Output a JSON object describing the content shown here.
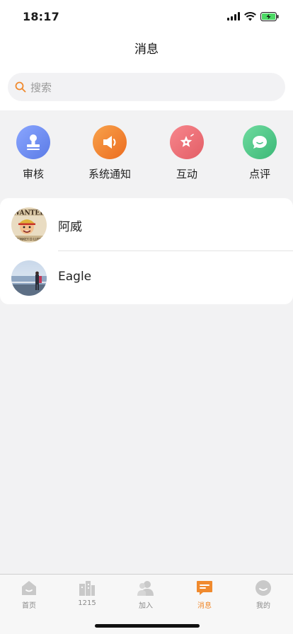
{
  "status_bar": {
    "time": "18:17"
  },
  "header": {
    "title": "消息"
  },
  "search": {
    "placeholder": "搜索"
  },
  "categories": [
    {
      "label": "审核",
      "icon": "stamp-icon",
      "color": "#6b8cf0"
    },
    {
      "label": "系统通知",
      "icon": "speaker-icon",
      "color": "#f0822e"
    },
    {
      "label": "互动",
      "icon": "star-icon",
      "color": "#ee6f76"
    },
    {
      "label": "点评",
      "icon": "chat-bubble-icon",
      "color": "#4fc98b"
    }
  ],
  "conversations": [
    {
      "name": "阿威",
      "avatar": "wanted-poster-avatar"
    },
    {
      "name": "Eagle",
      "avatar": "seaside-photo-avatar"
    }
  ],
  "tabs": [
    {
      "label": "首页",
      "icon": "home-icon",
      "active": false
    },
    {
      "label": "1215",
      "icon": "buildings-icon",
      "active": false
    },
    {
      "label": "加入",
      "icon": "people-icon",
      "active": false
    },
    {
      "label": "消息",
      "icon": "message-icon",
      "active": true
    },
    {
      "label": "我的",
      "icon": "profile-icon",
      "active": false
    }
  ],
  "colors": {
    "accent": "#f08a2e",
    "background": "#f2f2f3"
  }
}
